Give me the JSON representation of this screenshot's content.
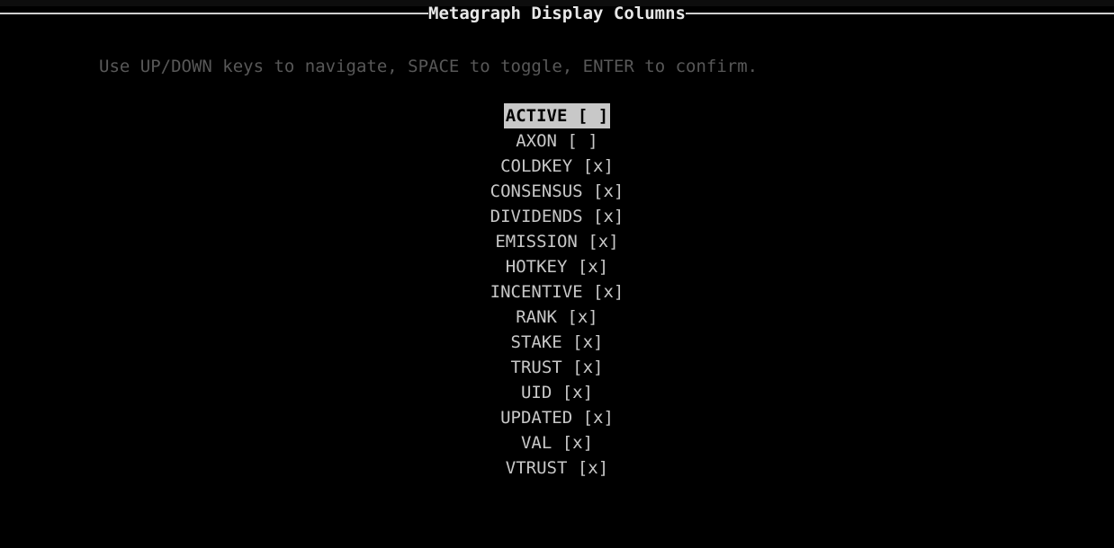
{
  "screen": {
    "background_color": "#000000",
    "text_color": "#c8c8c8",
    "title_color": "#e8e8e8",
    "hint_color": "#585858",
    "highlight_background_color": "#c8c8c8",
    "highlight_text_color": "#000000"
  },
  "title": {
    "text": "Metagraph Display Columns"
  },
  "hint": {
    "text": "Use UP/DOWN keys to navigate, SPACE to toggle, ENTER to confirm."
  },
  "list": {
    "selected_index": 0,
    "checked_mark": "[x]",
    "unchecked_mark": "[ ]",
    "items": [
      {
        "label": "ACTIVE",
        "mark": "[ ]",
        "text": "ACTIVE [ ]",
        "checked": false,
        "selected": true
      },
      {
        "label": "AXON",
        "mark": "[ ]",
        "text": "AXON [ ]",
        "checked": false,
        "selected": false
      },
      {
        "label": "COLDKEY",
        "mark": "[x]",
        "text": "COLDKEY [x]",
        "checked": true,
        "selected": false
      },
      {
        "label": "CONSENSUS",
        "mark": "[x]",
        "text": "CONSENSUS [x]",
        "checked": true,
        "selected": false
      },
      {
        "label": "DIVIDENDS",
        "mark": "[x]",
        "text": "DIVIDENDS [x]",
        "checked": true,
        "selected": false
      },
      {
        "label": "EMISSION",
        "mark": "[x]",
        "text": "EMISSION [x]",
        "checked": true,
        "selected": false
      },
      {
        "label": "HOTKEY",
        "mark": "[x]",
        "text": "HOTKEY [x]",
        "checked": true,
        "selected": false
      },
      {
        "label": "INCENTIVE",
        "mark": "[x]",
        "text": "INCENTIVE [x]",
        "checked": true,
        "selected": false
      },
      {
        "label": "RANK",
        "mark": "[x]",
        "text": "RANK [x]",
        "checked": true,
        "selected": false
      },
      {
        "label": "STAKE",
        "mark": "[x]",
        "text": "STAKE [x]",
        "checked": true,
        "selected": false
      },
      {
        "label": "TRUST",
        "mark": "[x]",
        "text": "TRUST [x]",
        "checked": true,
        "selected": false
      },
      {
        "label": "UID",
        "mark": "[x]",
        "text": "UID [x]",
        "checked": true,
        "selected": false
      },
      {
        "label": "UPDATED",
        "mark": "[x]",
        "text": "UPDATED [x]",
        "checked": true,
        "selected": false
      },
      {
        "label": "VAL",
        "mark": "[x]",
        "text": "VAL [x]",
        "checked": true,
        "selected": false
      },
      {
        "label": "VTRUST",
        "mark": "[x]",
        "text": "VTRUST [x]",
        "checked": true,
        "selected": false
      }
    ]
  }
}
